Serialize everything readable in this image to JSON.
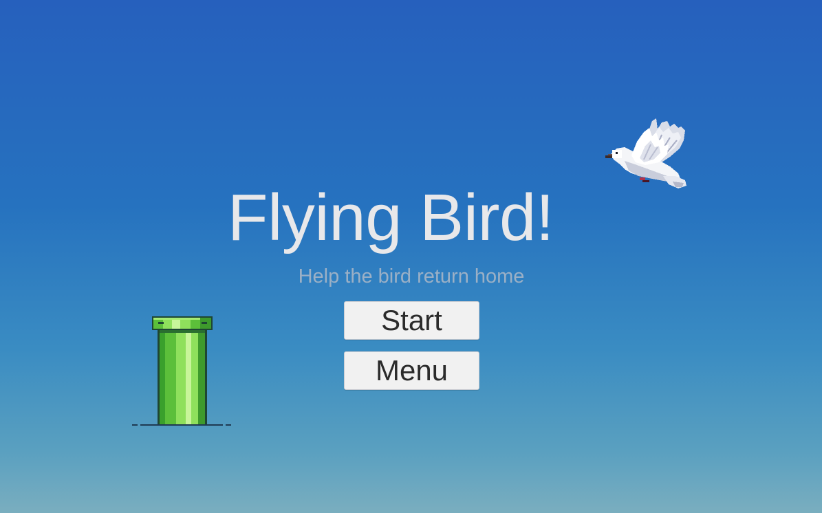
{
  "game": {
    "title": "Flying Bird!",
    "subtitle": "Help the bird return home"
  },
  "buttons": {
    "start_label": "Start",
    "menu_label": "Menu"
  },
  "colors": {
    "sky_top": "#2660bd",
    "sky_bottom": "#7aaebf",
    "title_text": "#e8e8ea",
    "subtitle_text": "#9bb0c6",
    "button_bg": "#f1f1f1",
    "pipe_green": "#5cbf3a"
  },
  "sprites": {
    "bird": "white-dove-icon",
    "obstacle": "green-pipe-icon"
  }
}
